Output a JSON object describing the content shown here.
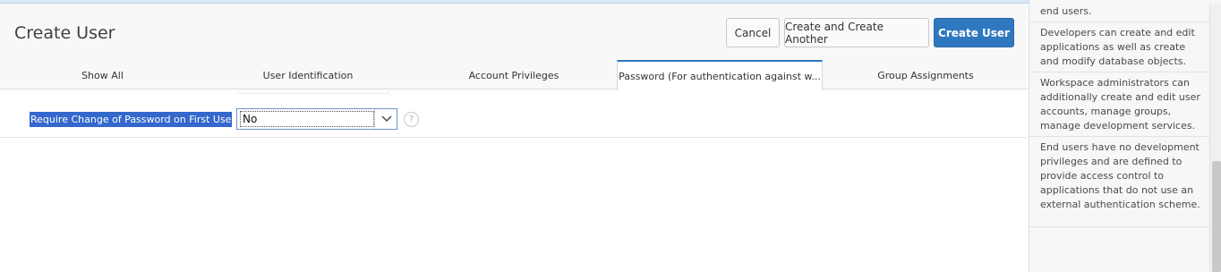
{
  "page": {
    "title": "Create User"
  },
  "buttons": {
    "cancel": "Cancel",
    "create_another": "Create and Create Another",
    "create_user": "Create User"
  },
  "tabs": [
    {
      "label": "Show All"
    },
    {
      "label": "User Identification"
    },
    {
      "label": "Account Privileges"
    },
    {
      "label": "Password (For authentication against w..."
    },
    {
      "label": "Group Assignments"
    }
  ],
  "field": {
    "label": "Require Change of Password on First Use",
    "value": "No",
    "help_icon_glyph": "?"
  },
  "side_panel": {
    "paragraphs": [
      "end users.",
      "Developers can create and edit applications as well as create and modify database objects.",
      "Workspace administrators can additionally create and edit user accounts, manage groups, manage development services.",
      "End users have no development privileges and are defined to provide access control to applications that do not use an external authentication scheme."
    ]
  },
  "colors": {
    "primary_button": "#2f78bf",
    "active_tab_border": "#3077bd",
    "selected_label_bg": "#3468cc"
  }
}
